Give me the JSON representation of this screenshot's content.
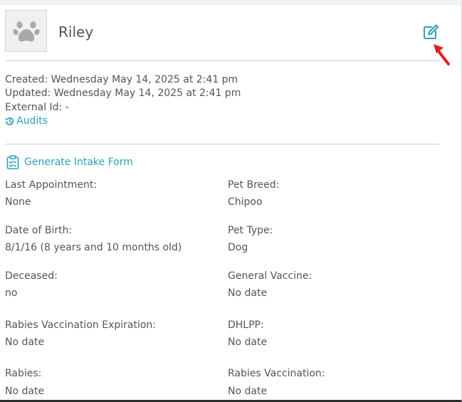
{
  "pet": {
    "name": "Riley"
  },
  "meta": {
    "created": "Created: Wednesday May 14, 2025 at 2:41 pm",
    "updated": "Updated: Wednesday May 14, 2025 at 2:41 pm",
    "external_id": "External Id: -"
  },
  "links": {
    "audits": "Audits",
    "generate_intake": "Generate Intake Form"
  },
  "fields": {
    "last_appointment": {
      "label": "Last Appointment:",
      "value": "None"
    },
    "pet_breed": {
      "label": "Pet Breed:",
      "value": "Chipoo"
    },
    "date_of_birth": {
      "label": "Date of Birth:",
      "value": "8/1/16 (8 years and 10 months old)"
    },
    "pet_type": {
      "label": "Pet Type:",
      "value": "Dog"
    },
    "deceased": {
      "label": "Deceased:",
      "value": "no"
    },
    "general_vaccine": {
      "label": "General Vaccine:",
      "value": "No date"
    },
    "rabies_vaccination_expiration": {
      "label": "Rabies Vaccination Expiration:",
      "value": "No date"
    },
    "dhlpp": {
      "label": "DHLPP:",
      "value": "No date"
    },
    "rabies": {
      "label": "Rabies:",
      "value": "No date"
    },
    "rabies_vaccination": {
      "label": "Rabies Vaccination:",
      "value": "No date"
    }
  },
  "icons": {
    "avatar": "paw-icon",
    "edit": "edit-icon",
    "audits": "history-icon",
    "intake": "clipboard-icon",
    "pointer": "red-arrow-icon"
  },
  "colors": {
    "accent": "#2aa0bd",
    "arrow": "#e02020",
    "text": "#555555"
  }
}
